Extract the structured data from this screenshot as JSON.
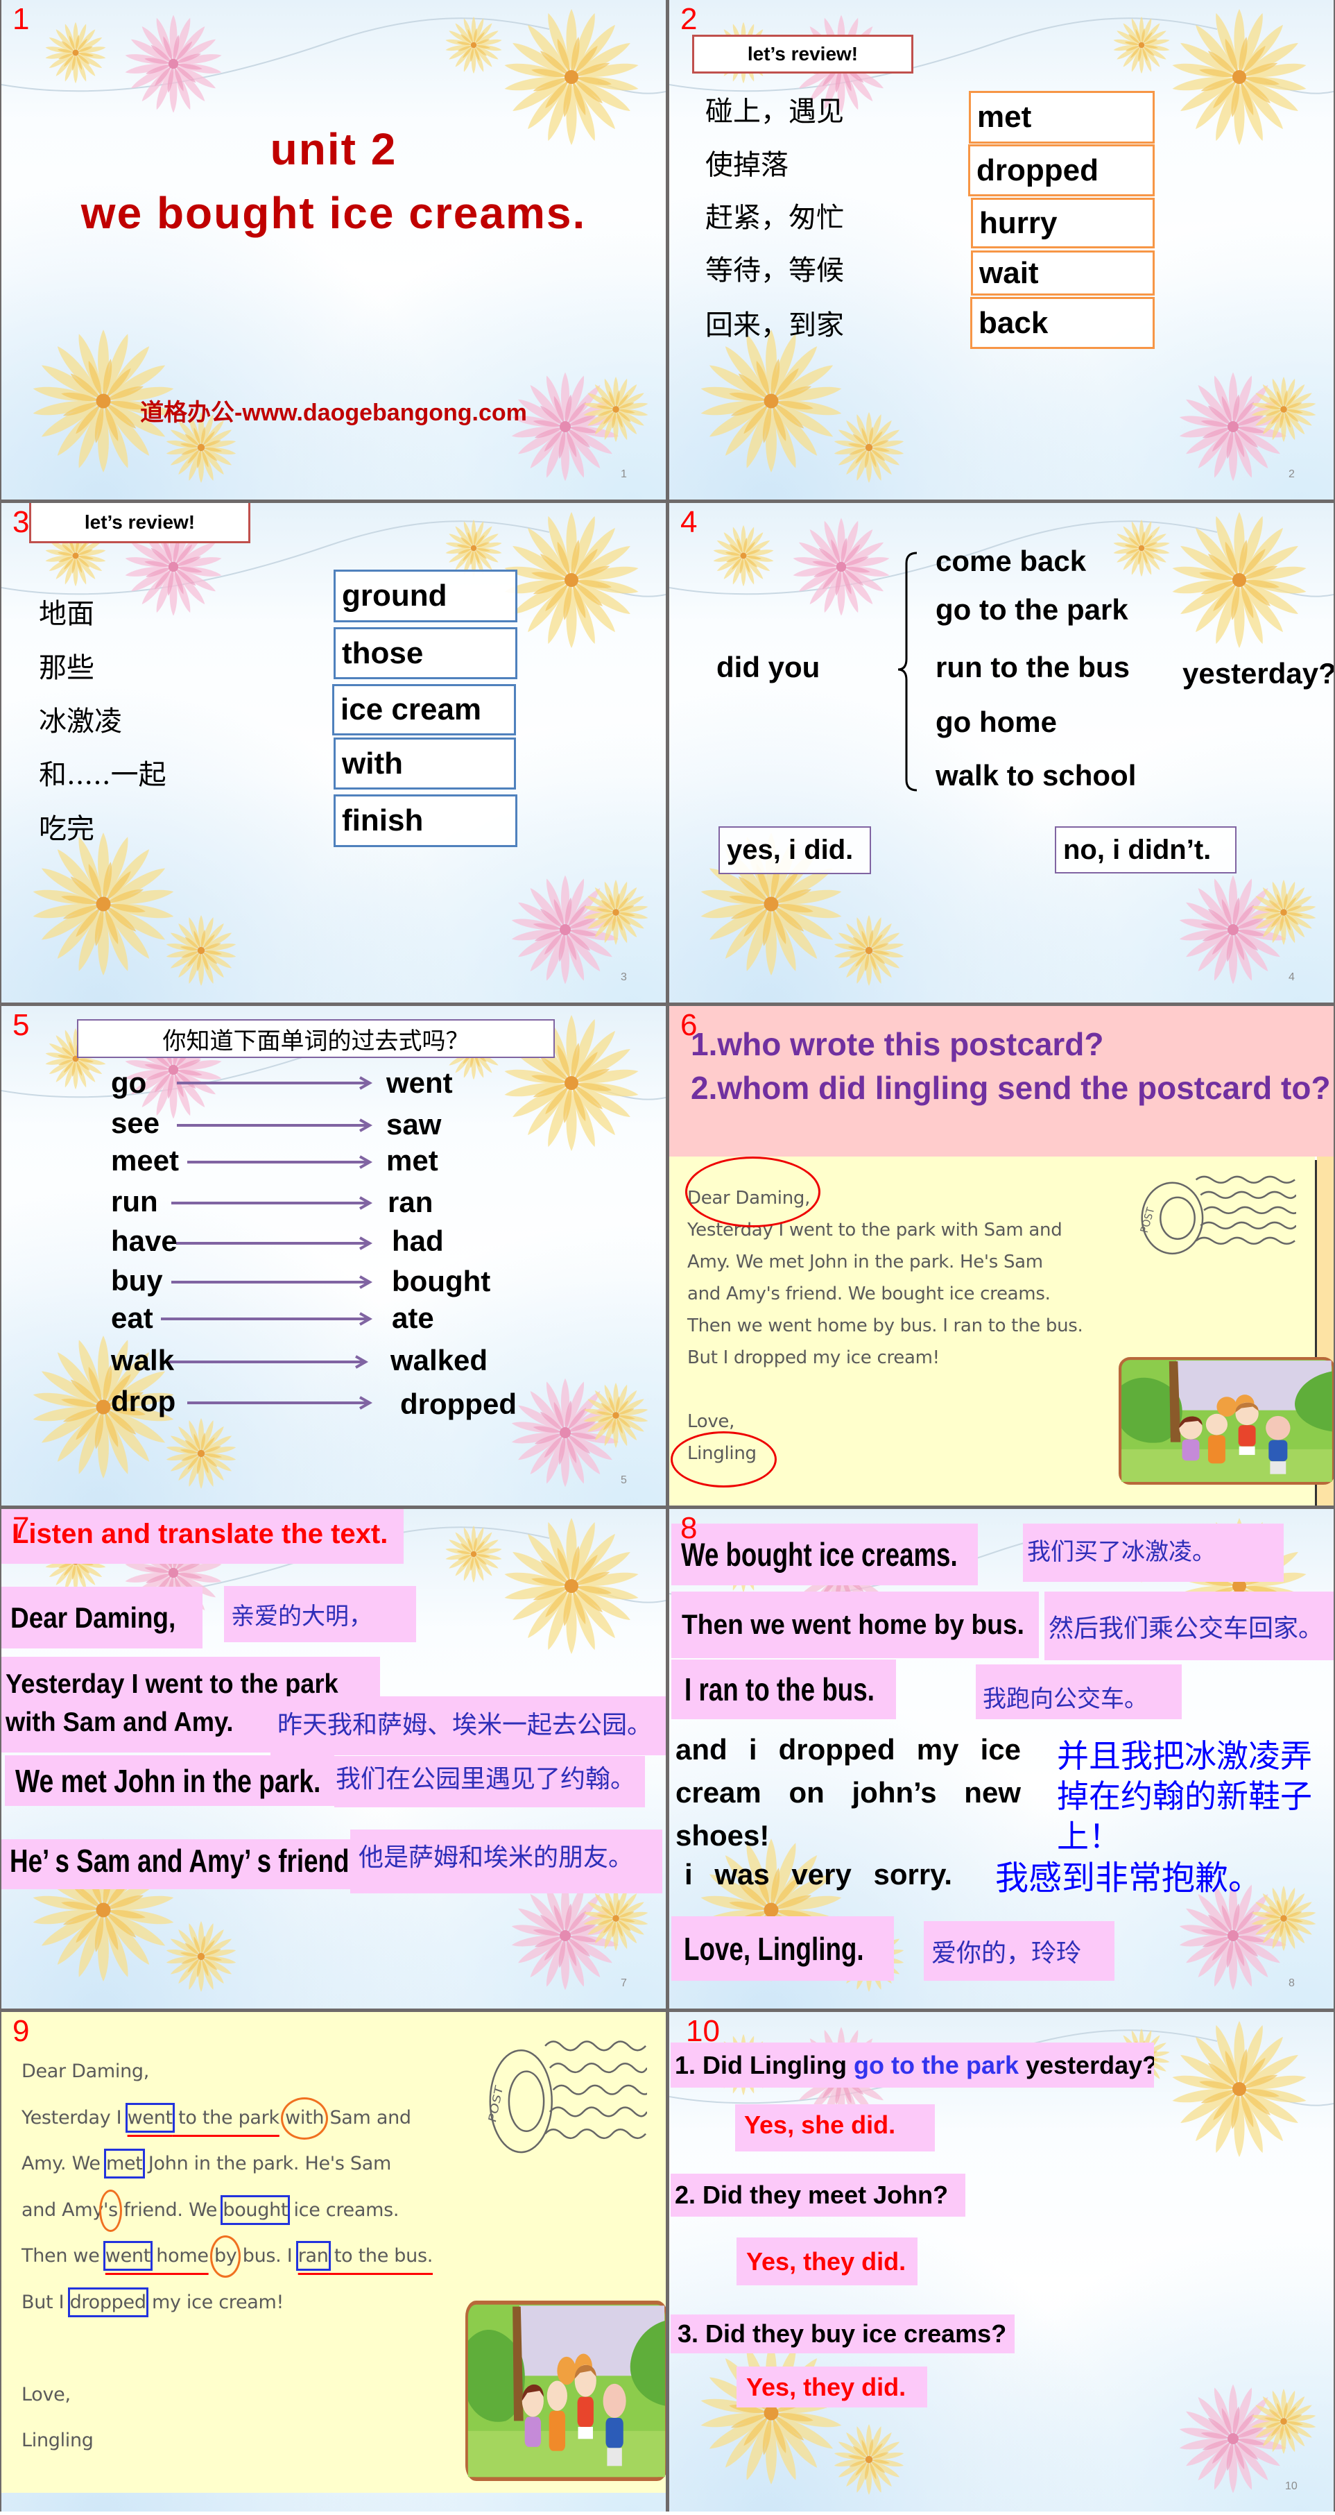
{
  "colors": {
    "index_label_red": "#ff0000",
    "title_dark_red": "#c00000",
    "review_box_border": "#c0504d",
    "orange_box_border": "#f79646",
    "blue_box_border": "#4f81bd",
    "purple_accent": "#8064a2",
    "question_purple": "#7030a0",
    "question_band_pink": "#ffcccc",
    "postcard_yellow": "#ffffcc",
    "postcard_text_gray": "#5a5a5a",
    "pink_highlight": "#fcc9f9",
    "translation_blue": "#2e2eb8",
    "bright_blue": "#0000ff",
    "answer_red": "#ff0000",
    "phrase_blue": "#3333ee",
    "annotation_box_blue": "#2233dd",
    "annotation_circle_orange": "#f07020",
    "annotation_underline_red": "#ff0000",
    "ellipse_red": "#ee0000"
  },
  "slides": [
    {
      "index_label": "1",
      "page_number": "1",
      "title_line1": "unit 2",
      "title_line2": "we bought ice creams.",
      "watermark": "道格办公-www.daogebangong.com"
    },
    {
      "index_label": "2",
      "page_number": "2",
      "header": "let’s review!",
      "rows": [
        {
          "zh": "碰上，遇见",
          "en": "met"
        },
        {
          "zh": "使掉落",
          "en": "dropped"
        },
        {
          "zh": "赶紧，匆忙",
          "en": "hurry"
        },
        {
          "zh": "等待，等候",
          "en": "wait"
        },
        {
          "zh": "回来，到家",
          "en": "back"
        }
      ]
    },
    {
      "index_label": "3",
      "page_number": "3",
      "header": "let’s review!",
      "rows": [
        {
          "zh": "地面",
          "en": "ground"
        },
        {
          "zh": "那些",
          "en": "those"
        },
        {
          "zh": "冰激凌",
          "en": "ice cream"
        },
        {
          "zh": "和.....一起",
          "en": "with"
        },
        {
          "zh": "吃完",
          "en": "finish"
        }
      ]
    },
    {
      "index_label": "4",
      "page_number": "4",
      "prefix": "did you",
      "options": [
        "come back",
        "go to the park",
        "run to the bus",
        "go home",
        "walk to school"
      ],
      "suffix": "yesterday?",
      "answer_yes": "yes, i did.",
      "answer_no": "no, i didn’t."
    },
    {
      "index_label": "5",
      "page_number": "5",
      "header": "你知道下面单词的过去式吗？",
      "pairs": [
        {
          "base": "go",
          "past": "went"
        },
        {
          "base": "see",
          "past": "saw"
        },
        {
          "base": "meet",
          "past": "met"
        },
        {
          "base": "run",
          "past": "ran"
        },
        {
          "base": "have",
          "past": "had"
        },
        {
          "base": "buy",
          "past": "bought"
        },
        {
          "base": "eat",
          "past": "ate"
        },
        {
          "base": "walk",
          "past": "walked"
        },
        {
          "base": "drop",
          "past": "dropped"
        }
      ]
    },
    {
      "index_label": "6",
      "questions": [
        "1.who wrote this postcard?",
        "2.whom did lingling send the postcard to?"
      ],
      "postcard": {
        "stamp_text": "POST",
        "lines": [
          "Dear Daming,",
          "Yesterday I went to the park with Sam and",
          "Amy. We met John in the park. He's Sam",
          "and Amy's friend. We bought ice creams.",
          "Then we went home by bus. I ran to the bus.",
          "But I dropped my ice cream!",
          "",
          "Love,",
          "Lingling"
        ]
      }
    },
    {
      "index_label": "7",
      "page_number": "7",
      "title": "Listen and translate the text.",
      "pairs": [
        {
          "en": [
            "Dear Daming,"
          ],
          "zh": "亲爱的大明，"
        },
        {
          "en": [
            "Yesterday I went to the park",
            "with Sam and Amy."
          ],
          "zh": "昨天我和萨姆、埃米一起去公园。"
        },
        {
          "en": [
            "We met John in the park."
          ],
          "zh": "我们在公园里遇见了约翰。"
        },
        {
          "en": [
            "He’ s Sam and Amy’ s friend"
          ],
          "zh": "他是萨姆和埃米的朋友。"
        }
      ]
    },
    {
      "index_label": "8",
      "page_number": "8",
      "pairs": [
        {
          "en": "We bought ice creams.",
          "zh": "我们买了冰激凌。"
        },
        {
          "en": "Then we went home by bus.",
          "zh": "然后我们乘公交车回家。"
        },
        {
          "en": "I ran to the bus.",
          "zh": "我跑向公交车。"
        }
      ],
      "paragraph": {
        "en": "and i dropped my ice cream on john’s new shoes!",
        "zh": "并且我把冰激凌弄掉在约翰的新鞋子上！"
      },
      "sorry": {
        "en": "i was very sorry.",
        "zh": "我感到非常抱歉。"
      },
      "closing": {
        "en": "Love, Lingling.",
        "zh": "爱你的，玲玲"
      }
    },
    {
      "index_label": "9",
      "postcard": {
        "stamp_text": "POST",
        "lines": [
          [
            {
              "text": "Dear Daming,"
            }
          ],
          [
            {
              "text": "Yesterday I "
            },
            {
              "text": "went",
              "marks": [
                "box",
                "underline"
              ]
            },
            {
              "text": " to the park",
              "marks": [
                "underline"
              ]
            },
            {
              "text": " "
            },
            {
              "text": "with",
              "marks": [
                "circle"
              ]
            },
            {
              "text": " Sam and"
            }
          ],
          [
            {
              "text": "Amy. We "
            },
            {
              "text": "met",
              "marks": [
                "box"
              ]
            },
            {
              "text": " John in the park. He's Sam"
            }
          ],
          [
            {
              "text": "and Amy"
            },
            {
              "text": "'s",
              "marks": [
                "circle"
              ]
            },
            {
              "text": " friend. We "
            },
            {
              "text": "bought",
              "marks": [
                "box"
              ]
            },
            {
              "text": " ice creams."
            }
          ],
          [
            {
              "text": "Then we "
            },
            {
              "text": "went",
              "marks": [
                "box",
                "underline"
              ]
            },
            {
              "text": " home",
              "marks": [
                "underline"
              ]
            },
            {
              "text": " "
            },
            {
              "text": "by",
              "marks": [
                "circle"
              ]
            },
            {
              "text": " bus. I "
            },
            {
              "text": "ran",
              "marks": [
                "box",
                "underline"
              ]
            },
            {
              "text": " to the bus.",
              "marks": [
                "underline"
              ]
            }
          ],
          [
            {
              "text": "But I "
            },
            {
              "text": "dropped",
              "marks": [
                "box"
              ]
            },
            {
              "text": " my ice cream!"
            }
          ],
          [],
          [
            {
              "text": "Love,"
            }
          ],
          [
            {
              "text": "Lingling"
            }
          ]
        ]
      }
    },
    {
      "index_label": "10",
      "page_number": "10",
      "qa": [
        {
          "question": [
            {
              "text": "1. Did Lingling "
            },
            {
              "text": "go to the park",
              "marks": [
                "highlight"
              ]
            },
            {
              "text": " yesterday?"
            }
          ],
          "answer": "Yes, she did."
        },
        {
          "question": [
            {
              "text": "2. Did they meet John?"
            }
          ],
          "answer": "Yes, they did."
        },
        {
          "question": [
            {
              "text": "3. Did they buy ice creams?"
            }
          ],
          "answer": "Yes, they did."
        }
      ]
    }
  ]
}
